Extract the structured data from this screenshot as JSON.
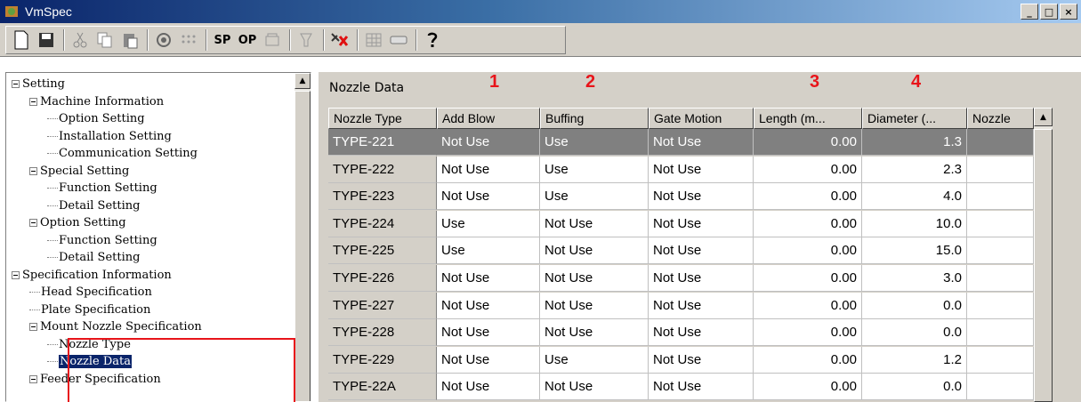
{
  "window": {
    "title": "VmSpec",
    "buttons": [
      "_",
      "□",
      "×"
    ]
  },
  "toolbar": {
    "buttons": [
      "new-icon",
      "save-icon",
      "cut-icon",
      "copy-icon",
      "paste-icon",
      "target-icon",
      "grid-dots-icon",
      "measure-icon",
      "filter-icon",
      "bug-icon",
      "table-icon",
      "device-icon",
      "help-icon"
    ],
    "sp_label": "SP",
    "op_label": "OP"
  },
  "tree": [
    {
      "label": "Setting",
      "level": 0,
      "expander": true
    },
    {
      "label": "Machine Information",
      "level": 1,
      "expander": true
    },
    {
      "label": "Option Setting",
      "level": 2
    },
    {
      "label": "Installation Setting",
      "level": 2
    },
    {
      "label": "Communication Setting",
      "level": 2
    },
    {
      "label": "Special Setting",
      "level": 1,
      "expander": true
    },
    {
      "label": "Function Setting",
      "level": 2
    },
    {
      "label": "Detail Setting",
      "level": 2
    },
    {
      "label": "Option Setting",
      "level": 1,
      "expander": true
    },
    {
      "label": "Function Setting",
      "level": 2
    },
    {
      "label": "Detail Setting",
      "level": 2
    },
    {
      "label": "Specification Information",
      "level": 0,
      "expander": true
    },
    {
      "label": "Head Specification",
      "level": 1
    },
    {
      "label": "Plate Specification",
      "level": 1
    },
    {
      "label": "Mount Nozzle Specification",
      "level": 1,
      "expander": true
    },
    {
      "label": "Nozzle Type",
      "level": 2
    },
    {
      "label": "Nozzle Data",
      "level": 2,
      "selected": true
    },
    {
      "label": "Feeder Specification",
      "level": 1,
      "expander": true
    }
  ],
  "main": {
    "panel_title": "Nozzle Data",
    "annotations": [
      "1",
      "2",
      "3",
      "4"
    ],
    "columns": [
      "Nozzle Type",
      "Add Blow",
      "Buffing",
      "Gate Motion",
      "Length (m...",
      "Diameter (...",
      "Nozzle"
    ],
    "rows": [
      [
        "TYPE-221",
        "Not Use",
        "Use",
        "Not Use",
        "0.00",
        "1.3"
      ],
      [
        "TYPE-222",
        "Not Use",
        "Use",
        "Not Use",
        "0.00",
        "2.3"
      ],
      [
        "TYPE-223",
        "Not Use",
        "Use",
        "Not Use",
        "0.00",
        "4.0"
      ],
      [
        "TYPE-224",
        "Use",
        "Not Use",
        "Not Use",
        "0.00",
        "10.0"
      ],
      [
        "TYPE-225",
        "Use",
        "Not Use",
        "Not Use",
        "0.00",
        "15.0"
      ],
      [
        "TYPE-226",
        "Not Use",
        "Not Use",
        "Not Use",
        "0.00",
        "3.0"
      ],
      [
        "TYPE-227",
        "Not Use",
        "Not Use",
        "Not Use",
        "0.00",
        "0.0"
      ],
      [
        "TYPE-228",
        "Not Use",
        "Not Use",
        "Not Use",
        "0.00",
        "0.0"
      ],
      [
        "TYPE-229",
        "Not Use",
        "Use",
        "Not Use",
        "0.00",
        "1.2"
      ],
      [
        "TYPE-22A",
        "Not Use",
        "Not Use",
        "Not Use",
        "0.00",
        "0.0"
      ]
    ],
    "selected_row": 0
  },
  "colors": {
    "accent": "#0a246a",
    "annotation": "#e8141a",
    "chrome": "#d4d0c8"
  }
}
